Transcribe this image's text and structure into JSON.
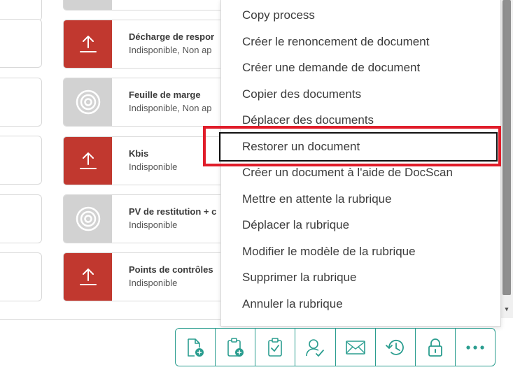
{
  "documents": [
    {
      "title": "Décharge de respor",
      "status": "Indisponible, Non ap",
      "thumb": "upload-icon",
      "thumb_color": "#c1382f"
    },
    {
      "title": "Feuille de marge",
      "status": "Indisponible, Non ap",
      "thumb": "target-icon",
      "thumb_color": "#d2d2d2"
    },
    {
      "title": "Kbis",
      "status": "Indisponible",
      "thumb": "upload-icon",
      "thumb_color": "#c1382f"
    },
    {
      "title": "PV de restitution + c",
      "status": "Indisponible",
      "thumb": "target-icon",
      "thumb_color": "#d2d2d2"
    },
    {
      "title": "Points de contrôles",
      "status": "Indisponible",
      "thumb": "upload-icon",
      "thumb_color": "#c1382f"
    }
  ],
  "context_menu": {
    "items": [
      "Copy process",
      "Créer le renoncement de document",
      "Créer une demande de document",
      "Copier des documents",
      "Déplacer des documents",
      "Restorer un document",
      "Créer un document à l'aide de DocScan",
      "Mettre en attente la rubrique",
      "Déplacer la rubrique",
      "Modifier le modèle de la rubrique",
      "Supprimer la rubrique",
      "Annuler la rubrique"
    ],
    "focused_item": "Restorer un document"
  },
  "toolbar": {
    "icons": [
      "new-document-icon",
      "clipboard-add-icon",
      "clipboard-check-icon",
      "user-check-icon",
      "mail-icon",
      "history-icon",
      "lock-icon",
      "more-icon"
    ]
  },
  "colors": {
    "accent": "#2a9d8f",
    "thumb_red": "#c1382f",
    "thumb_grey": "#d2d2d2",
    "highlight": "#e01d2a"
  }
}
